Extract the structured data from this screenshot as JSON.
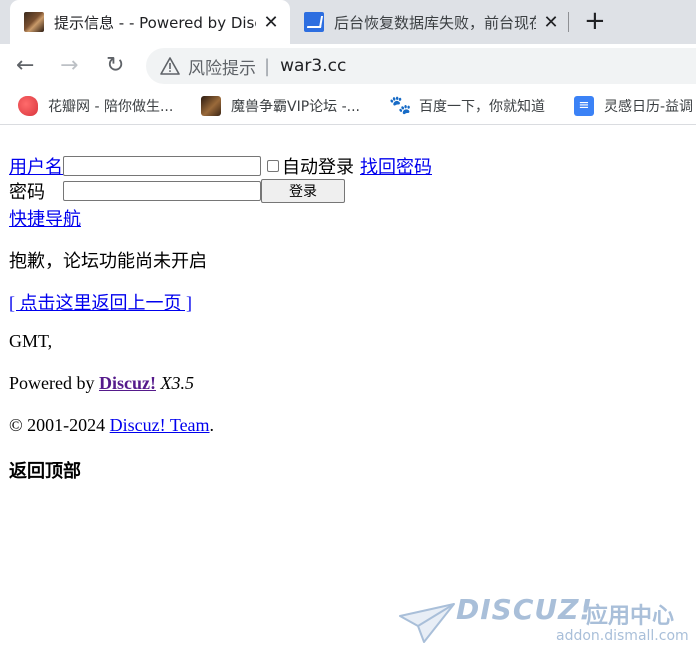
{
  "browser": {
    "tabs": [
      {
        "title": "提示信息 - - Powered by Discuz!",
        "close": "✕"
      },
      {
        "title": "后台恢复数据库失败，前台现在打不开了",
        "close": "✕"
      }
    ],
    "new_tab": "+",
    "nav": {
      "back": "←",
      "forward": "→",
      "reload": "↻"
    },
    "address": {
      "security": "风险提示",
      "separator": "|",
      "url": "war3.cc"
    },
    "bookmarks": [
      {
        "label": "花瓣网 - 陪你做生...",
        "icon": "huaban-icon"
      },
      {
        "label": "魔兽争霸VIP论坛 -...",
        "icon": "war3-icon"
      },
      {
        "label": "百度一下，你就知道",
        "icon": "baidu-icon"
      },
      {
        "label": "灵感日历-益调",
        "icon": "calendar-icon"
      }
    ],
    "baidu_glyph": "🐾",
    "calendar_glyph": "≡"
  },
  "login": {
    "username_label": "用户名",
    "password_label": "密码",
    "autologin_label": "自动登录",
    "forgot_link": "找回密码",
    "login_button": "登录",
    "quicknav_link": "快捷导航"
  },
  "message": {
    "text": "抱歉，论坛功能尚未开启",
    "back_link": "[ 点击这里返回上一页 ]"
  },
  "footer": {
    "time": "GMT,",
    "powered_prefix": "Powered by ",
    "powered_link": "Discuz!",
    "version": " X3.5",
    "copyright_prefix": "© 2001-2024 ",
    "team_link": "Discuz! Team",
    "copyright_suffix": ".",
    "back_top": "返回顶部"
  },
  "watermark": {
    "brand": "DISCUZ!",
    "cn": "应用中心",
    "domain": "addon.dismall.com"
  }
}
